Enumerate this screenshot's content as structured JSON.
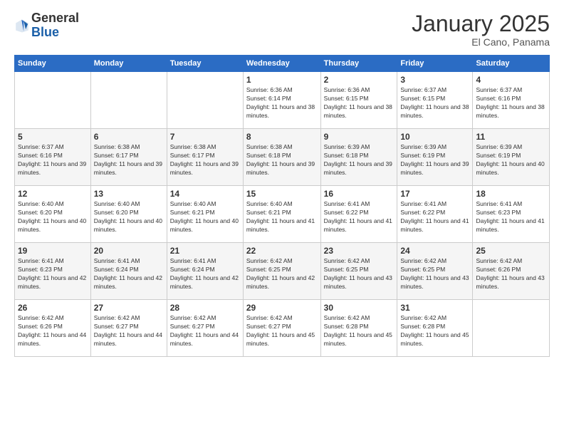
{
  "header": {
    "logo_general": "General",
    "logo_blue": "Blue",
    "month_title": "January 2025",
    "subtitle": "El Cano, Panama"
  },
  "days_of_week": [
    "Sunday",
    "Monday",
    "Tuesday",
    "Wednesday",
    "Thursday",
    "Friday",
    "Saturday"
  ],
  "weeks": [
    [
      {
        "day": "",
        "info": ""
      },
      {
        "day": "",
        "info": ""
      },
      {
        "day": "",
        "info": ""
      },
      {
        "day": "1",
        "info": "Sunrise: 6:36 AM\nSunset: 6:14 PM\nDaylight: 11 hours and 38 minutes."
      },
      {
        "day": "2",
        "info": "Sunrise: 6:36 AM\nSunset: 6:15 PM\nDaylight: 11 hours and 38 minutes."
      },
      {
        "day": "3",
        "info": "Sunrise: 6:37 AM\nSunset: 6:15 PM\nDaylight: 11 hours and 38 minutes."
      },
      {
        "day": "4",
        "info": "Sunrise: 6:37 AM\nSunset: 6:16 PM\nDaylight: 11 hours and 38 minutes."
      }
    ],
    [
      {
        "day": "5",
        "info": "Sunrise: 6:37 AM\nSunset: 6:16 PM\nDaylight: 11 hours and 39 minutes."
      },
      {
        "day": "6",
        "info": "Sunrise: 6:38 AM\nSunset: 6:17 PM\nDaylight: 11 hours and 39 minutes."
      },
      {
        "day": "7",
        "info": "Sunrise: 6:38 AM\nSunset: 6:17 PM\nDaylight: 11 hours and 39 minutes."
      },
      {
        "day": "8",
        "info": "Sunrise: 6:38 AM\nSunset: 6:18 PM\nDaylight: 11 hours and 39 minutes."
      },
      {
        "day": "9",
        "info": "Sunrise: 6:39 AM\nSunset: 6:18 PM\nDaylight: 11 hours and 39 minutes."
      },
      {
        "day": "10",
        "info": "Sunrise: 6:39 AM\nSunset: 6:19 PM\nDaylight: 11 hours and 39 minutes."
      },
      {
        "day": "11",
        "info": "Sunrise: 6:39 AM\nSunset: 6:19 PM\nDaylight: 11 hours and 40 minutes."
      }
    ],
    [
      {
        "day": "12",
        "info": "Sunrise: 6:40 AM\nSunset: 6:20 PM\nDaylight: 11 hours and 40 minutes."
      },
      {
        "day": "13",
        "info": "Sunrise: 6:40 AM\nSunset: 6:20 PM\nDaylight: 11 hours and 40 minutes."
      },
      {
        "day": "14",
        "info": "Sunrise: 6:40 AM\nSunset: 6:21 PM\nDaylight: 11 hours and 40 minutes."
      },
      {
        "day": "15",
        "info": "Sunrise: 6:40 AM\nSunset: 6:21 PM\nDaylight: 11 hours and 41 minutes."
      },
      {
        "day": "16",
        "info": "Sunrise: 6:41 AM\nSunset: 6:22 PM\nDaylight: 11 hours and 41 minutes."
      },
      {
        "day": "17",
        "info": "Sunrise: 6:41 AM\nSunset: 6:22 PM\nDaylight: 11 hours and 41 minutes."
      },
      {
        "day": "18",
        "info": "Sunrise: 6:41 AM\nSunset: 6:23 PM\nDaylight: 11 hours and 41 minutes."
      }
    ],
    [
      {
        "day": "19",
        "info": "Sunrise: 6:41 AM\nSunset: 6:23 PM\nDaylight: 11 hours and 42 minutes."
      },
      {
        "day": "20",
        "info": "Sunrise: 6:41 AM\nSunset: 6:24 PM\nDaylight: 11 hours and 42 minutes."
      },
      {
        "day": "21",
        "info": "Sunrise: 6:41 AM\nSunset: 6:24 PM\nDaylight: 11 hours and 42 minutes."
      },
      {
        "day": "22",
        "info": "Sunrise: 6:42 AM\nSunset: 6:25 PM\nDaylight: 11 hours and 42 minutes."
      },
      {
        "day": "23",
        "info": "Sunrise: 6:42 AM\nSunset: 6:25 PM\nDaylight: 11 hours and 43 minutes."
      },
      {
        "day": "24",
        "info": "Sunrise: 6:42 AM\nSunset: 6:25 PM\nDaylight: 11 hours and 43 minutes."
      },
      {
        "day": "25",
        "info": "Sunrise: 6:42 AM\nSunset: 6:26 PM\nDaylight: 11 hours and 43 minutes."
      }
    ],
    [
      {
        "day": "26",
        "info": "Sunrise: 6:42 AM\nSunset: 6:26 PM\nDaylight: 11 hours and 44 minutes."
      },
      {
        "day": "27",
        "info": "Sunrise: 6:42 AM\nSunset: 6:27 PM\nDaylight: 11 hours and 44 minutes."
      },
      {
        "day": "28",
        "info": "Sunrise: 6:42 AM\nSunset: 6:27 PM\nDaylight: 11 hours and 44 minutes."
      },
      {
        "day": "29",
        "info": "Sunrise: 6:42 AM\nSunset: 6:27 PM\nDaylight: 11 hours and 45 minutes."
      },
      {
        "day": "30",
        "info": "Sunrise: 6:42 AM\nSunset: 6:28 PM\nDaylight: 11 hours and 45 minutes."
      },
      {
        "day": "31",
        "info": "Sunrise: 6:42 AM\nSunset: 6:28 PM\nDaylight: 11 hours and 45 minutes."
      },
      {
        "day": "",
        "info": ""
      }
    ]
  ]
}
